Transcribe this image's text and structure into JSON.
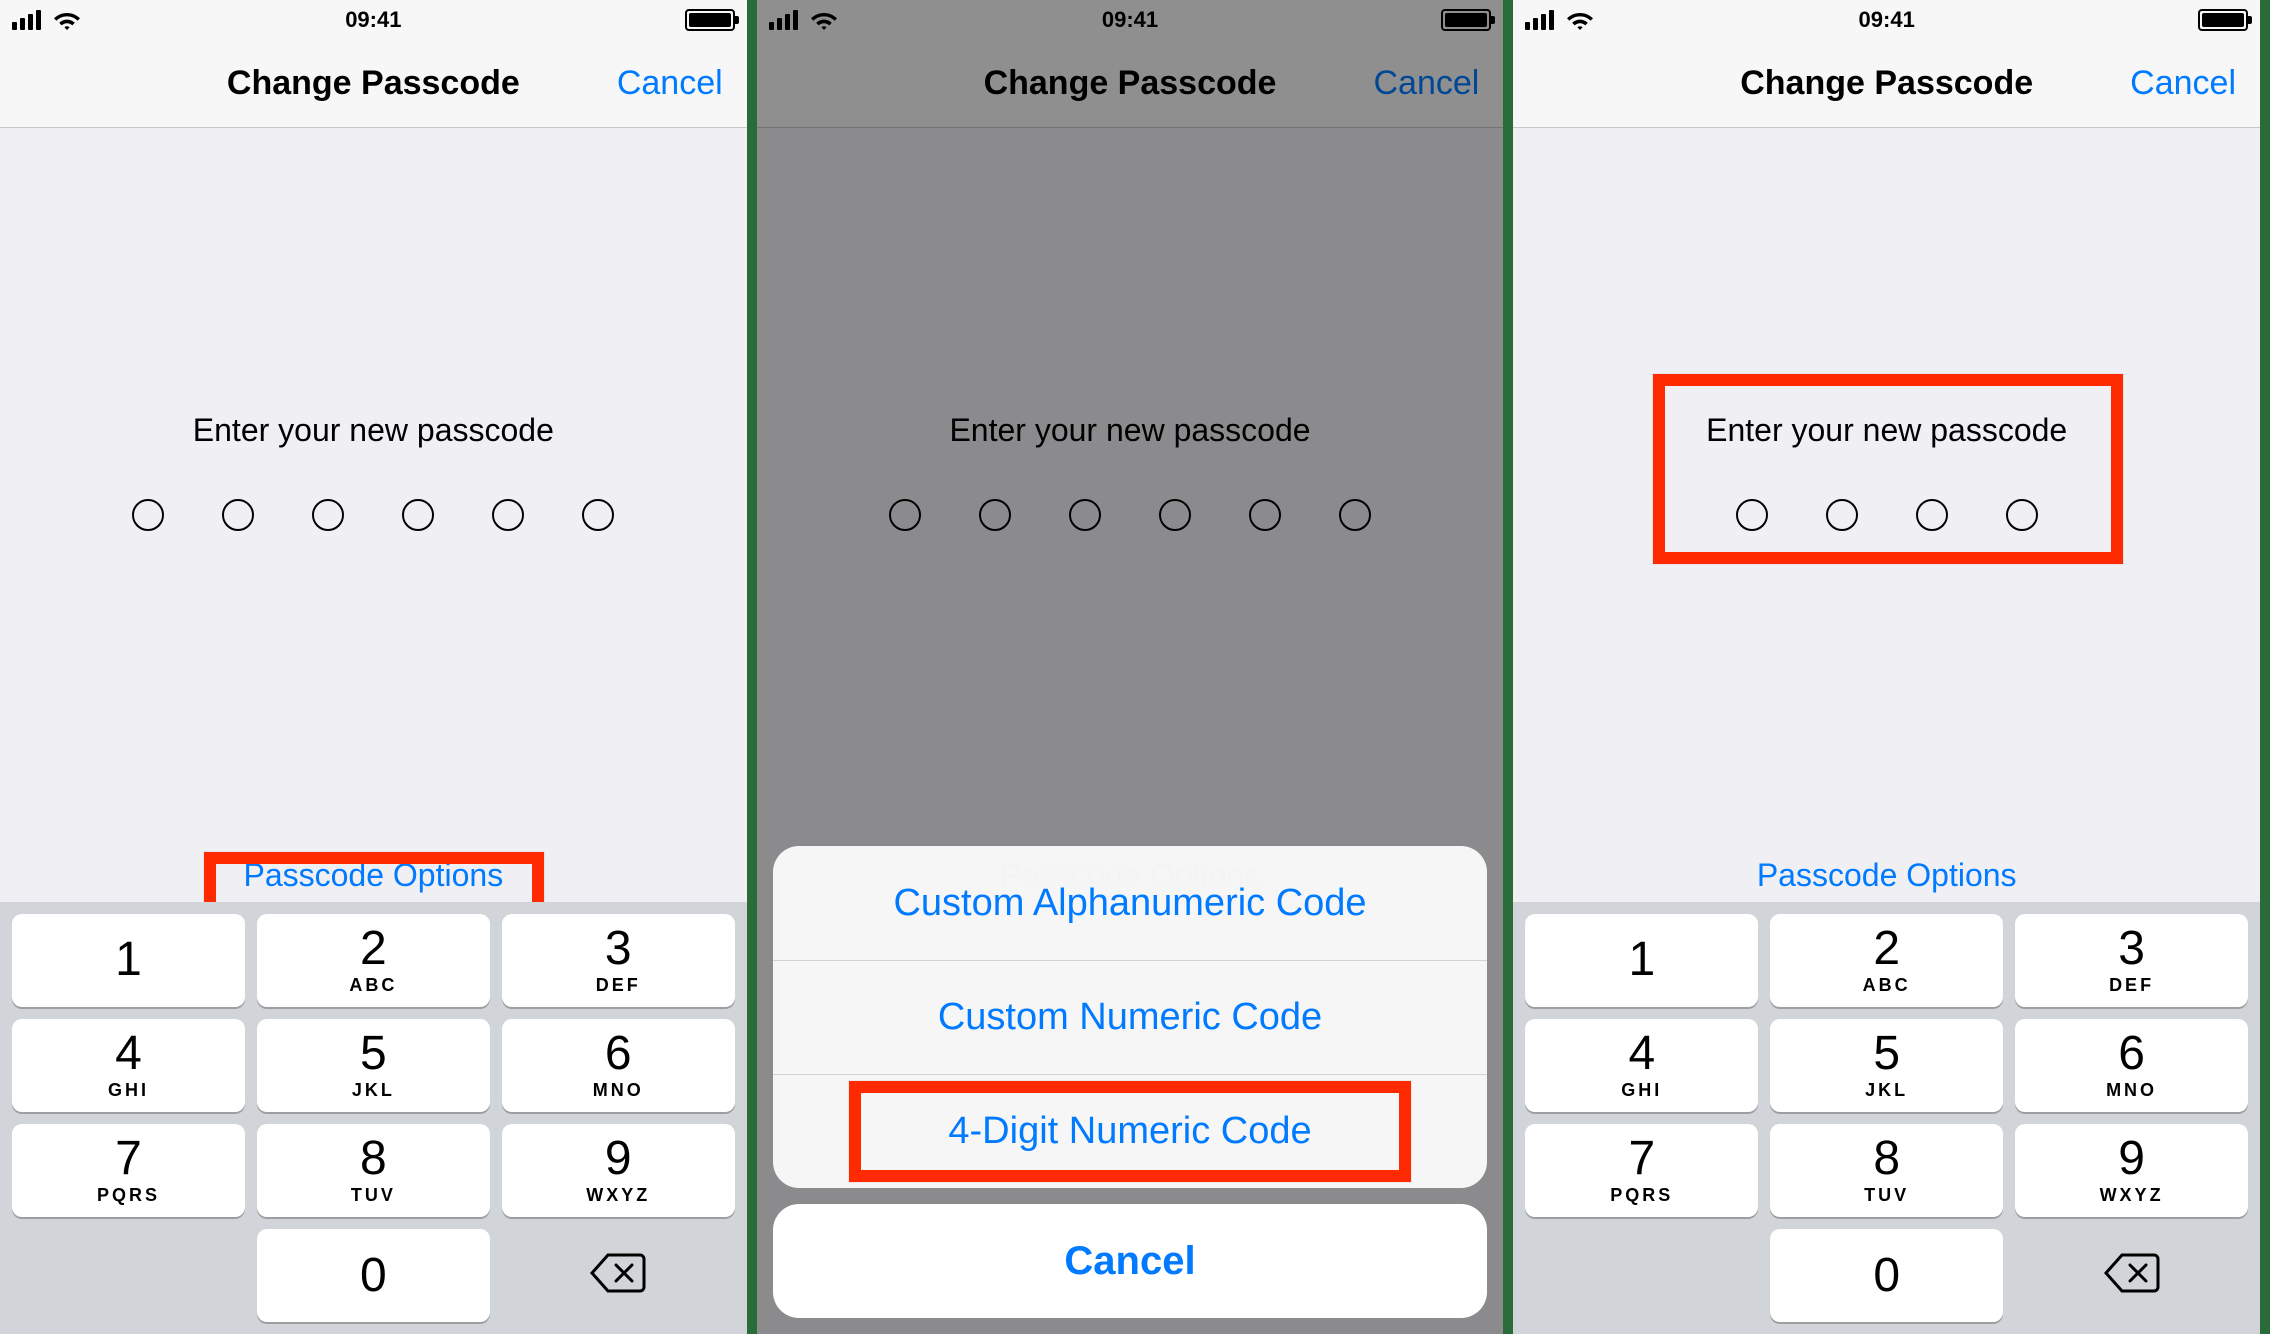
{
  "status": {
    "time": "09:41"
  },
  "nav": {
    "title": "Change Passcode",
    "cancel": "Cancel"
  },
  "prompt": "Enter your new passcode",
  "passcode_options_label": "Passcode Options",
  "keypad": {
    "k1": {
      "num": "1",
      "letters": " "
    },
    "k2": {
      "num": "2",
      "letters": "ABC"
    },
    "k3": {
      "num": "3",
      "letters": "DEF"
    },
    "k4": {
      "num": "4",
      "letters": "GHI"
    },
    "k5": {
      "num": "5",
      "letters": "JKL"
    },
    "k6": {
      "num": "6",
      "letters": "MNO"
    },
    "k7": {
      "num": "7",
      "letters": "PQRS"
    },
    "k8": {
      "num": "8",
      "letters": "TUV"
    },
    "k9": {
      "num": "9",
      "letters": "WXYZ"
    },
    "k0": {
      "num": "0",
      "letters": ""
    }
  },
  "sheet": {
    "opt1": "Custom Alphanumeric Code",
    "opt2": "Custom Numeric Code",
    "opt3": "4-Digit Numeric Code",
    "cancel": "Cancel"
  },
  "screens": {
    "left": {
      "dot_count": 6
    },
    "middle": {
      "dot_count": 6
    },
    "right": {
      "dot_count": 4
    }
  }
}
